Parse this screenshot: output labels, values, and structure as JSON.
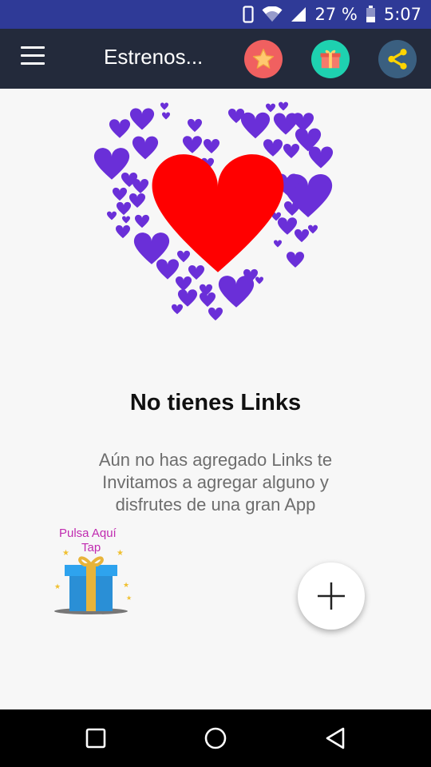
{
  "status_bar": {
    "battery": "27 %",
    "time": "5:07"
  },
  "toolbar": {
    "title": "Estrenos...",
    "icons": [
      "menu-icon",
      "star-icon",
      "gift-icon",
      "share-icon"
    ]
  },
  "empty_state": {
    "title": "No tienes Links",
    "message": "Aún no has agregado Links te Invitamos a agregar alguno y disfrutes de una gran App"
  },
  "promo": {
    "line1": "Pulsa   Aquí",
    "line2": "Tap"
  },
  "fab": {
    "icon": "plus-icon"
  },
  "nav_bar": {
    "icons": [
      "back-icon",
      "home-icon",
      "recents-icon"
    ]
  },
  "colors": {
    "status_bar": "#2f3a97",
    "toolbar": "#232a3b",
    "heart_big": "#ff0000",
    "heart_small": "#6a2fd8",
    "star_button": "#f06060",
    "gift_button": "#1ed1b0",
    "share_button": "#3a5f80"
  }
}
